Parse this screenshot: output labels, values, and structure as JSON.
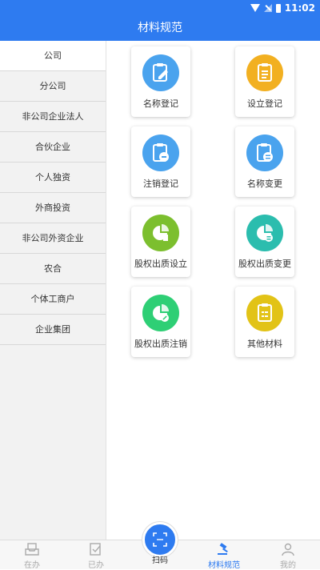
{
  "status_bar": {
    "time": "11:02"
  },
  "header": {
    "title": "材料规范"
  },
  "sidebar": {
    "items": [
      {
        "label": "公司"
      },
      {
        "label": "分公司"
      },
      {
        "label": "非公司企业法人"
      },
      {
        "label": "合伙企业"
      },
      {
        "label": "个人独资"
      },
      {
        "label": "外商投资"
      },
      {
        "label": "非公司外资企业"
      },
      {
        "label": "农合"
      },
      {
        "label": "个体工商户"
      },
      {
        "label": "企业集团"
      }
    ],
    "selected": "公司"
  },
  "grid": {
    "tiles": [
      {
        "label": "名称登记",
        "icon": "clipboard-edit-icon",
        "color": "#4aa3ee"
      },
      {
        "label": "设立登记",
        "icon": "clipboard-list-icon",
        "color": "#f2b021"
      },
      {
        "label": "注销登记",
        "icon": "clipboard-cancel-icon",
        "color": "#4aa3ee"
      },
      {
        "label": "名称变更",
        "icon": "clipboard-change-icon",
        "color": "#4aa3ee"
      },
      {
        "label": "股权出质设立",
        "icon": "pie-chart-icon",
        "color": "#7cbf2e"
      },
      {
        "label": "股权出质变更",
        "icon": "pie-chart-change-icon",
        "color": "#2bbdae"
      },
      {
        "label": "股权出质注销",
        "icon": "pie-chart-cancel-icon",
        "color": "#2ecf75"
      },
      {
        "label": "其他材料",
        "icon": "clipboard-other-icon",
        "color": "#e2c317"
      }
    ]
  },
  "bottom_nav": {
    "tabs": [
      {
        "label": "在办",
        "icon": "inbox-icon"
      },
      {
        "label": "已办",
        "icon": "done-list-icon"
      },
      {
        "label": "扫码",
        "icon": "scan-icon"
      },
      {
        "label": "材料规范",
        "icon": "gavel-icon"
      },
      {
        "label": "我的",
        "icon": "user-icon"
      }
    ],
    "active": "材料规范",
    "colors": {
      "active": "#2e7bf0",
      "inactive": "#aaaaaa"
    }
  },
  "colors": {
    "brand": "#2e7bf0"
  }
}
